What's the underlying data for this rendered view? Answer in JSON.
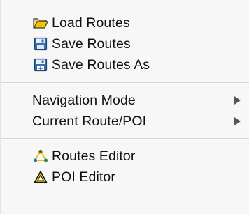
{
  "menu": {
    "items": [
      {
        "label": "Load Routes",
        "icon": "open-folder-icon"
      },
      {
        "label": "Save Routes",
        "icon": "floppy-disk-icon"
      },
      {
        "label": "Save Routes As",
        "icon": "floppy-disk-save-as-icon"
      },
      {
        "label": "Navigation Mode",
        "icon": "",
        "submenu": true
      },
      {
        "label": "Current Route/POI",
        "icon": "",
        "submenu": true
      },
      {
        "label": "Routes Editor",
        "icon": "route-triangle-icon"
      },
      {
        "label": "POI Editor",
        "icon": "warning-triangle-icon"
      }
    ]
  },
  "colors": {
    "menu_background": "#f7f7f7",
    "text": "#111111",
    "separator": "#d6d6d6",
    "icon_yellow": "#f2c200",
    "icon_blue": "#2f6fb8"
  }
}
